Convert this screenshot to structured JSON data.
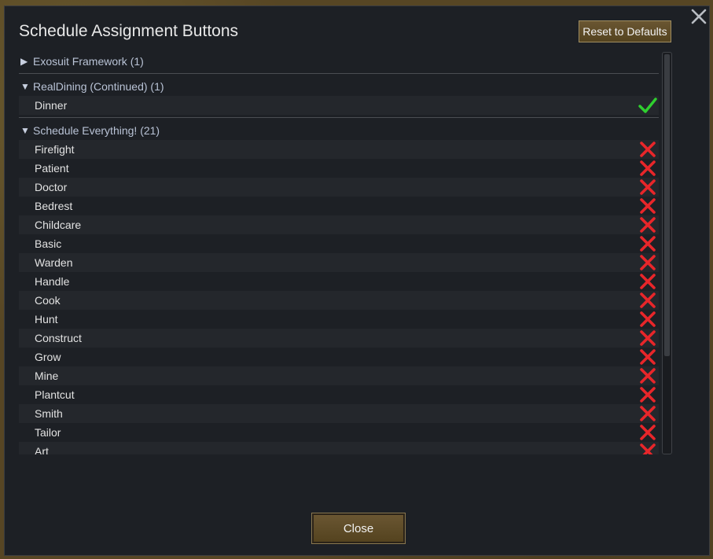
{
  "window": {
    "title": "Schedule Assignment Buttons",
    "reset_label": "Reset to Defaults",
    "close_label": "Close"
  },
  "colors": {
    "check": "#2fcf2f",
    "cross": "#e8262a",
    "button": "#5e4b28"
  },
  "groups": [
    {
      "label": "Exosuit Framework (1)",
      "expanded": false,
      "items": []
    },
    {
      "label": "RealDining (Continued) (1)",
      "expanded": true,
      "items": [
        {
          "label": "Dinner",
          "enabled": true
        }
      ]
    },
    {
      "label": "Schedule Everything! (21)",
      "expanded": true,
      "items": [
        {
          "label": "Firefight",
          "enabled": false
        },
        {
          "label": "Patient",
          "enabled": false
        },
        {
          "label": "Doctor",
          "enabled": false
        },
        {
          "label": "Bedrest",
          "enabled": false
        },
        {
          "label": "Childcare",
          "enabled": false
        },
        {
          "label": "Basic",
          "enabled": false
        },
        {
          "label": "Warden",
          "enabled": false
        },
        {
          "label": "Handle",
          "enabled": false
        },
        {
          "label": "Cook",
          "enabled": false
        },
        {
          "label": "Hunt",
          "enabled": false
        },
        {
          "label": "Construct",
          "enabled": false
        },
        {
          "label": "Grow",
          "enabled": false
        },
        {
          "label": "Mine",
          "enabled": false
        },
        {
          "label": "Plantcut",
          "enabled": false
        },
        {
          "label": "Smith",
          "enabled": false
        },
        {
          "label": "Tailor",
          "enabled": false
        },
        {
          "label": "Art",
          "enabled": false
        }
      ]
    }
  ],
  "scroll": {
    "thumb_fraction": 0.77,
    "position_fraction": 0.0
  }
}
